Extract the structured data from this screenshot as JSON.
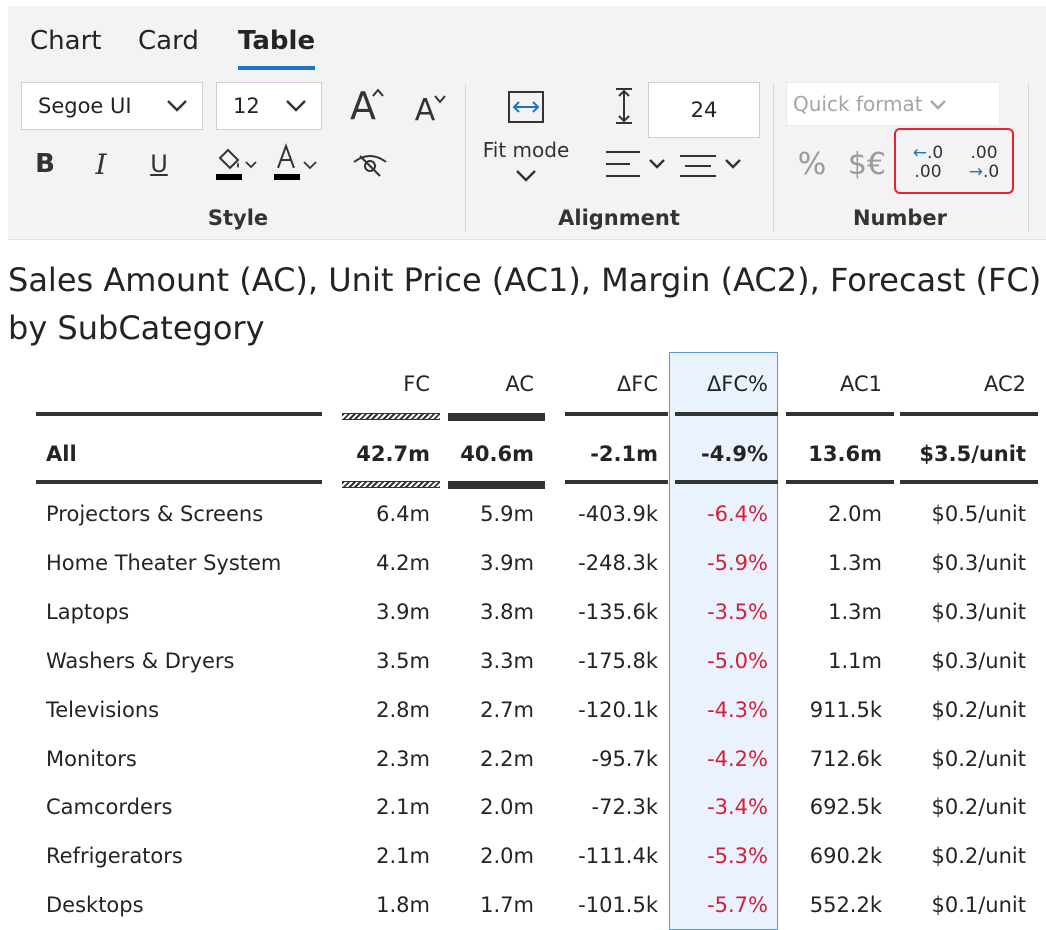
{
  "tabs": [
    "Chart",
    "Card",
    "Table"
  ],
  "active_tab": "Table",
  "style_group": {
    "label": "Style",
    "font_family": "Segoe UI",
    "font_size": "12",
    "bold": "B",
    "italic": "I",
    "underline": "U",
    "grow_font": "A",
    "shrink_font": "A",
    "fill_color": "#000000",
    "font_color": "#000000"
  },
  "alignment_group": {
    "label": "Alignment",
    "fit_mode": "Fit mode",
    "row_height": "24"
  },
  "number_group": {
    "label": "Number",
    "quick_format": "Quick format",
    "percent": "%",
    "currency": "$€",
    "dec_increase_top": "←.0",
    "dec_increase_bottom": ".00",
    "dec_decrease_top": ".00",
    "dec_decrease_bottom": "→.0",
    "highlight_color": "#e8212e"
  },
  "title": "Sales Amount (AC), Unit Price (AC1), Margin (AC2), Forecast (FC) by SubCategory",
  "table": {
    "columns": [
      "FC",
      "AC",
      "ΔFC",
      "ΔFC%",
      "AC1",
      "AC2"
    ],
    "highlighted_column": "ΔFC%",
    "total": {
      "name": "All",
      "FC": "42.7m",
      "AC": "40.6m",
      "dFC": "-2.1m",
      "dFCp": "-4.9%",
      "AC1": "13.6m",
      "AC2": "$3.5/unit"
    },
    "rows": [
      {
        "name": "Projectors & Screens",
        "FC": "6.4m",
        "AC": "5.9m",
        "dFC": "-403.9k",
        "dFCp": "-6.4%",
        "AC1": "2.0m",
        "AC2": "$0.5/unit"
      },
      {
        "name": "Home Theater System",
        "FC": "4.2m",
        "AC": "3.9m",
        "dFC": "-248.3k",
        "dFCp": "-5.9%",
        "AC1": "1.3m",
        "AC2": "$0.3/unit"
      },
      {
        "name": "Laptops",
        "FC": "3.9m",
        "AC": "3.8m",
        "dFC": "-135.6k",
        "dFCp": "-3.5%",
        "AC1": "1.3m",
        "AC2": "$0.3/unit"
      },
      {
        "name": "Washers & Dryers",
        "FC": "3.5m",
        "AC": "3.3m",
        "dFC": "-175.8k",
        "dFCp": "-5.0%",
        "AC1": "1.1m",
        "AC2": "$0.3/unit"
      },
      {
        "name": "Televisions",
        "FC": "2.8m",
        "AC": "2.7m",
        "dFC": "-120.1k",
        "dFCp": "-4.3%",
        "AC1": "911.5k",
        "AC2": "$0.2/unit"
      },
      {
        "name": "Monitors",
        "FC": "2.3m",
        "AC": "2.2m",
        "dFC": "-95.7k",
        "dFCp": "-4.2%",
        "AC1": "712.6k",
        "AC2": "$0.2/unit"
      },
      {
        "name": "Camcorders",
        "FC": "2.1m",
        "AC": "2.0m",
        "dFC": "-72.3k",
        "dFCp": "-3.4%",
        "AC1": "692.5k",
        "AC2": "$0.2/unit"
      },
      {
        "name": "Refrigerators",
        "FC": "2.1m",
        "AC": "2.0m",
        "dFC": "-111.4k",
        "dFCp": "-5.3%",
        "AC1": "690.2k",
        "AC2": "$0.2/unit"
      },
      {
        "name": "Desktops",
        "FC": "1.8m",
        "AC": "1.7m",
        "dFC": "-101.5k",
        "dFCp": "-5.7%",
        "AC1": "552.2k",
        "AC2": "$0.1/unit"
      }
    ]
  }
}
